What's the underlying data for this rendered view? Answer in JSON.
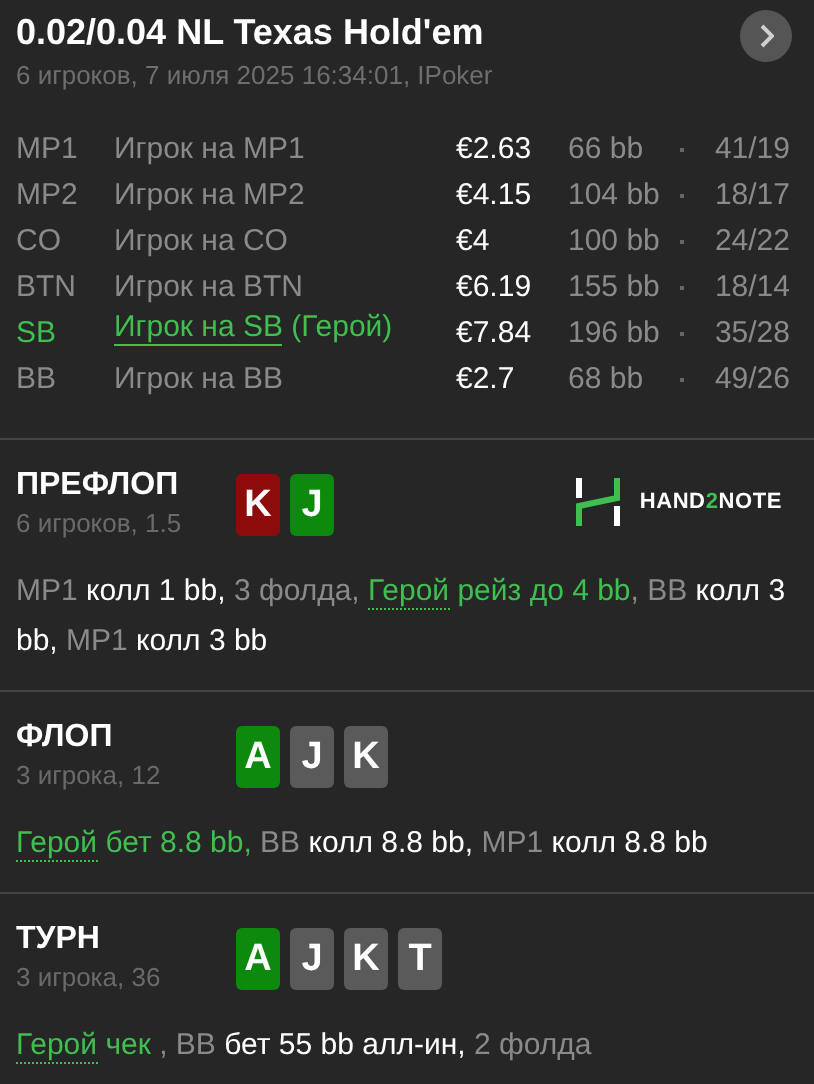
{
  "header": {
    "title": "0.02/0.04 NL Texas Hold'em",
    "subtitle": "6 игроков, 7 июля 2025 16:34:01, IPoker"
  },
  "players": [
    {
      "position": "MP1",
      "name": "Игрок на MP1",
      "stack": "€2.63",
      "bb": "66 bb",
      "stats": "41/19",
      "hero": false
    },
    {
      "position": "MP2",
      "name": "Игрок на MP2",
      "stack": "€4.15",
      "bb": "104 bb",
      "stats": "18/17",
      "hero": false
    },
    {
      "position": "CO",
      "name": "Игрок на CO",
      "stack": "€4",
      "bb": "100 bb",
      "stats": "24/22",
      "hero": false
    },
    {
      "position": "BTN",
      "name": "Игрок на BTN",
      "stack": "€6.19",
      "bb": "155 bb",
      "stats": "18/14",
      "hero": false
    },
    {
      "position": "SB",
      "name": "Игрок на SB",
      "hero_tag": "(Герой)",
      "stack": "€7.84",
      "bb": "196 bb",
      "stats": "35/28",
      "hero": true
    },
    {
      "position": "BB",
      "name": "Игрок на BB",
      "stack": "€2.7",
      "bb": "68 bb",
      "stats": "49/26",
      "hero": false
    }
  ],
  "streets": [
    {
      "name": "ПРЕФЛОП",
      "info": "6 игроков, 1.5",
      "cards": [
        {
          "rank": "K",
          "color": "#8e0b0b"
        },
        {
          "rank": "J",
          "color": "#0d8a0d"
        }
      ],
      "logo": [
        {
          "text": "HAND",
          "accent": false
        },
        {
          "text": "2",
          "accent": true
        },
        {
          "text": "NOTE",
          "accent": false
        }
      ],
      "actions": [
        {
          "text": "MP1",
          "kind": "player"
        },
        {
          "text": " колл 1 bb,",
          "kind": "action"
        },
        {
          "text": " 3 фолда, ",
          "kind": "player"
        },
        {
          "text": "Герой",
          "kind": "hero"
        },
        {
          "text": " рейз до 4 bb",
          "kind": "hero_action"
        },
        {
          "text": ", BB",
          "kind": "player"
        },
        {
          "text": " колл 3 bb,",
          "kind": "action"
        },
        {
          "text": " MP1",
          "kind": "player"
        },
        {
          "text": " колл 3 bb",
          "kind": "action"
        }
      ]
    },
    {
      "name": "ФЛОП",
      "info": "3 игрока, 12",
      "cards": [
        {
          "rank": "A",
          "color": "#0d8a0d"
        },
        {
          "rank": "J",
          "color": "#5a5a5a"
        },
        {
          "rank": "K",
          "color": "#5a5a5a"
        }
      ],
      "actions": [
        {
          "text": "Герой",
          "kind": "hero"
        },
        {
          "text": " бет 8.8 bb,",
          "kind": "hero_action"
        },
        {
          "text": " BB",
          "kind": "player"
        },
        {
          "text": " колл 8.8 bb,",
          "kind": "action"
        },
        {
          "text": " MP1",
          "kind": "player"
        },
        {
          "text": " колл 8.8 bb",
          "kind": "action"
        }
      ]
    },
    {
      "name": "ТУРН",
      "info": "3 игрока, 36",
      "cards": [
        {
          "rank": "A",
          "color": "#0d8a0d"
        },
        {
          "rank": "J",
          "color": "#5a5a5a"
        },
        {
          "rank": "K",
          "color": "#5a5a5a"
        },
        {
          "rank": "T",
          "color": "#5a5a5a"
        }
      ],
      "actions": [
        {
          "text": "Герой",
          "kind": "hero"
        },
        {
          "text": " чек ",
          "kind": "hero_action"
        },
        {
          "text": ", BB",
          "kind": "player"
        },
        {
          "text": " бет 55 bb алл-ин,",
          "kind": "action"
        },
        {
          "text": " 2 фолда",
          "kind": "player"
        }
      ]
    }
  ]
}
